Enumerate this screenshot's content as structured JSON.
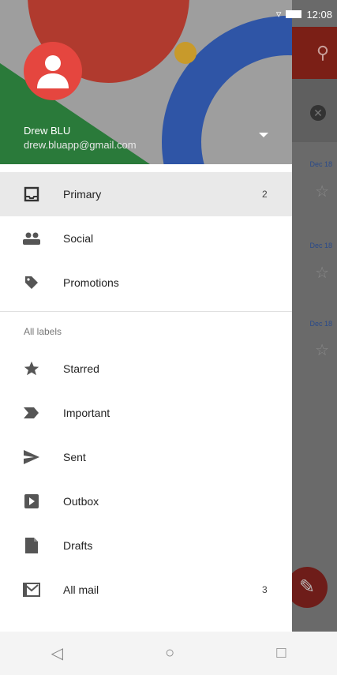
{
  "status_bar": {
    "time": "12:08"
  },
  "account": {
    "name": "Drew BLU",
    "email": "drew.bluapp@gmail.com"
  },
  "primary_items": [
    {
      "label": "Primary",
      "icon": "inbox-icon",
      "count": "2"
    },
    {
      "label": "Social",
      "icon": "people-icon",
      "count": ""
    },
    {
      "label": "Promotions",
      "icon": "tag-icon",
      "count": ""
    }
  ],
  "all_labels_heading": "All labels",
  "label_items": [
    {
      "label": "Starred",
      "icon": "star-icon",
      "count": ""
    },
    {
      "label": "Important",
      "icon": "important-icon",
      "count": ""
    },
    {
      "label": "Sent",
      "icon": "send-icon",
      "count": ""
    },
    {
      "label": "Outbox",
      "icon": "outbox-icon",
      "count": ""
    },
    {
      "label": "Drafts",
      "icon": "draft-icon",
      "count": ""
    },
    {
      "label": "All mail",
      "icon": "all-mail-icon",
      "count": "3"
    }
  ],
  "background_dates": [
    "Dec 18",
    "Dec 18",
    "Dec 18"
  ],
  "colors": {
    "avatar": "#e5463f",
    "selected_row": "#e9e9e9",
    "accent_red": "#b03a2e"
  }
}
